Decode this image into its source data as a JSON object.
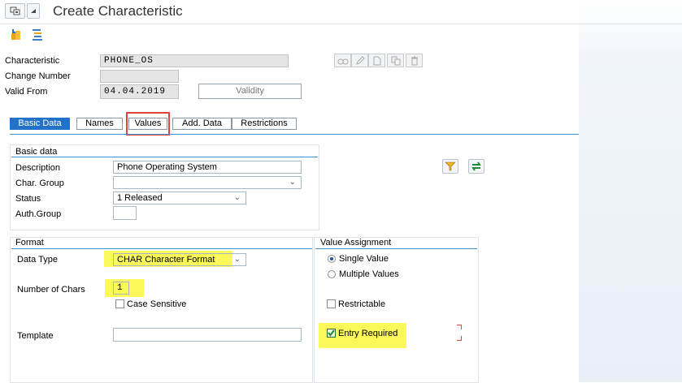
{
  "title": "Create Characteristic",
  "header_fields": [
    {
      "label": "Characteristic",
      "value": "PHONE_OS"
    },
    {
      "label": "Change Number",
      "value": ""
    },
    {
      "label": "Valid From",
      "value": "04.04.2019"
    }
  ],
  "validity_button": "Validity",
  "tabs": [
    "Basic Data",
    "Names",
    "Values",
    "Add. Data",
    "Restrictions"
  ],
  "basic_data": {
    "title": "Basic data",
    "description_label": "Description",
    "description_value": "Phone Operating System",
    "char_group_label": "Char. Group",
    "char_group_value": "",
    "status_label": "Status",
    "status_value": "1 Released",
    "auth_group_label": "Auth.Group",
    "auth_group_value": ""
  },
  "format": {
    "title": "Format",
    "data_type_label": "Data Type",
    "data_type_value": "CHAR Character Format",
    "num_chars_label": "Number of Chars",
    "num_chars_value": "1",
    "case_sensitive_label": "Case Sensitive",
    "template_label": "Template",
    "template_value": ""
  },
  "value_assignment": {
    "title": "Value Assignment",
    "single_value": "Single Value",
    "multiple_values": "Multiple Values",
    "restrictable": "Restrictable",
    "entry_required": "Entry Required"
  },
  "colors": {
    "active_tab": "#2472c8",
    "highlight": "#fbf85a",
    "annotation_box": "#e0443a",
    "group_line": "#3b8fd3"
  },
  "icons": [
    "menu-icon",
    "dropdown-icon",
    "transport-icon",
    "hierarchy-icon",
    "glasses-icon",
    "pencil-icon",
    "page-icon",
    "copy-icon",
    "trash-icon",
    "filter-icon",
    "refresh-icon"
  ]
}
